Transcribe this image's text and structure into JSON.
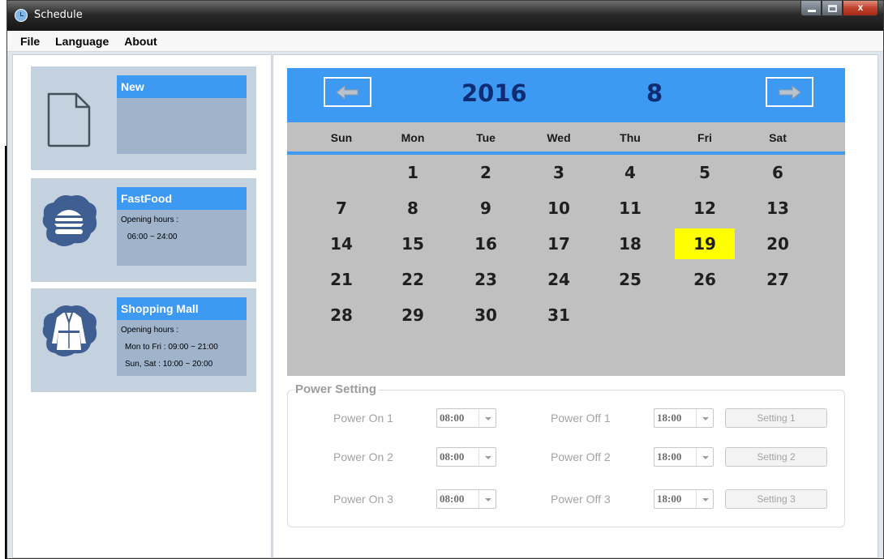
{
  "window": {
    "title": "Schedule"
  },
  "window_controls": {
    "close_glyph": "x"
  },
  "menu": [
    "File",
    "Language",
    "About"
  ],
  "templates": [
    {
      "title": "New",
      "icon": "document-icon",
      "lines": []
    },
    {
      "title": "FastFood",
      "icon": "burger-icon",
      "lines": [
        "Opening hours :",
        "06:00 ~ 24:00"
      ]
    },
    {
      "title": "Shopping Mall",
      "icon": "coat-icon",
      "lines": [
        "Opening hours :",
        "Mon to Fri : 09:00 ~ 21:00",
        "Sun, Sat : 10:00 ~ 20:00"
      ]
    }
  ],
  "calendar": {
    "year": "2016",
    "month": "8",
    "weekdays": [
      "Sun",
      "Mon",
      "Tue",
      "Wed",
      "Thu",
      "Fri",
      "Sat"
    ],
    "first_weekday_index": 1,
    "days_in_month": 31,
    "selected_day": 19,
    "selected_color": "#ffff00",
    "accent_color": "#3d99f1"
  },
  "power_setting": {
    "legend": "Power Setting",
    "rows": [
      {
        "on_label": "Power On 1",
        "on_value": "08:00",
        "off_label": "Power Off 1",
        "off_value": "18:00",
        "button": "Setting 1"
      },
      {
        "on_label": "Power On 2",
        "on_value": "08:00",
        "off_label": "Power Off 2",
        "off_value": "18:00",
        "button": "Setting 2"
      },
      {
        "on_label": "Power On 3",
        "on_value": "08:00",
        "off_label": "Power Off 3",
        "off_value": "18:00",
        "button": "Setting 3"
      }
    ]
  }
}
